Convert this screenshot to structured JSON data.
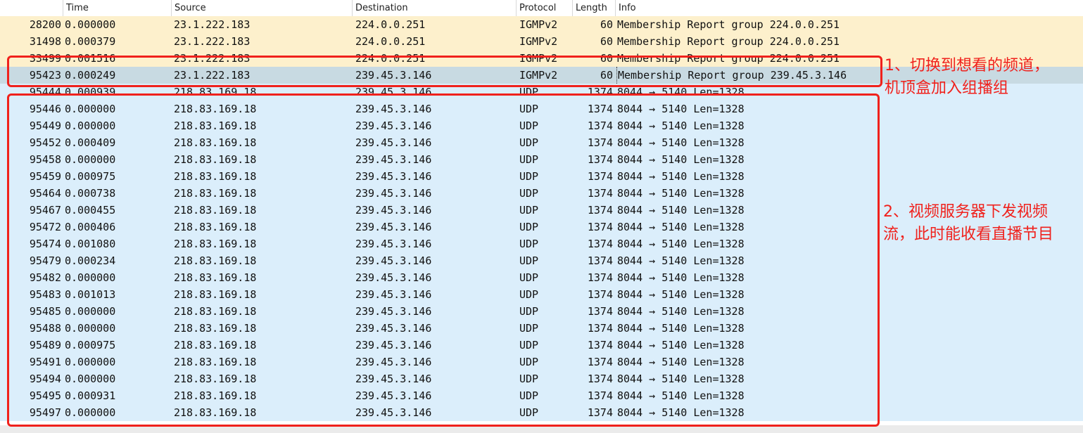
{
  "columns": {
    "no": "",
    "time": "Time",
    "source": "Source",
    "destination": "Destination",
    "protocol": "Protocol",
    "length": "Length",
    "info": "Info"
  },
  "packets": [
    {
      "no": "28200",
      "time": "0.000000",
      "source": "23.1.222.183",
      "destination": "224.0.0.251",
      "protocol": "IGMPv2",
      "length": "60",
      "info": "Membership Report group 224.0.0.251",
      "kind": "igmp"
    },
    {
      "no": "31498",
      "time": "0.000379",
      "source": "23.1.222.183",
      "destination": "224.0.0.251",
      "protocol": "IGMPv2",
      "length": "60",
      "info": "Membership Report group 224.0.0.251",
      "kind": "igmp"
    },
    {
      "no": "33499",
      "time": "0.001516",
      "source": "23.1.222.183",
      "destination": "224.0.0.251",
      "protocol": "IGMPv2",
      "length": "60",
      "info": "Membership Report group 224.0.0.251",
      "kind": "igmp"
    },
    {
      "no": "95423",
      "time": "0.000249",
      "source": "23.1.222.183",
      "destination": "239.45.3.146",
      "protocol": "IGMPv2",
      "length": "60",
      "info": "Membership Report group 239.45.3.146",
      "kind": "sel"
    },
    {
      "no": "95444",
      "time": "0.000939",
      "source": "218.83.169.18",
      "destination": "239.45.3.146",
      "protocol": "UDP",
      "length": "1374",
      "info": "8044 → 5140 Len=1328",
      "kind": "udp"
    },
    {
      "no": "95446",
      "time": "0.000000",
      "source": "218.83.169.18",
      "destination": "239.45.3.146",
      "protocol": "UDP",
      "length": "1374",
      "info": "8044 → 5140 Len=1328",
      "kind": "udp"
    },
    {
      "no": "95449",
      "time": "0.000000",
      "source": "218.83.169.18",
      "destination": "239.45.3.146",
      "protocol": "UDP",
      "length": "1374",
      "info": "8044 → 5140 Len=1328",
      "kind": "udp"
    },
    {
      "no": "95452",
      "time": "0.000409",
      "source": "218.83.169.18",
      "destination": "239.45.3.146",
      "protocol": "UDP",
      "length": "1374",
      "info": "8044 → 5140 Len=1328",
      "kind": "udp"
    },
    {
      "no": "95458",
      "time": "0.000000",
      "source": "218.83.169.18",
      "destination": "239.45.3.146",
      "protocol": "UDP",
      "length": "1374",
      "info": "8044 → 5140 Len=1328",
      "kind": "udp"
    },
    {
      "no": "95459",
      "time": "0.000975",
      "source": "218.83.169.18",
      "destination": "239.45.3.146",
      "protocol": "UDP",
      "length": "1374",
      "info": "8044 → 5140 Len=1328",
      "kind": "udp"
    },
    {
      "no": "95464",
      "time": "0.000738",
      "source": "218.83.169.18",
      "destination": "239.45.3.146",
      "protocol": "UDP",
      "length": "1374",
      "info": "8044 → 5140 Len=1328",
      "kind": "udp"
    },
    {
      "no": "95467",
      "time": "0.000455",
      "source": "218.83.169.18",
      "destination": "239.45.3.146",
      "protocol": "UDP",
      "length": "1374",
      "info": "8044 → 5140 Len=1328",
      "kind": "udp"
    },
    {
      "no": "95472",
      "time": "0.000406",
      "source": "218.83.169.18",
      "destination": "239.45.3.146",
      "protocol": "UDP",
      "length": "1374",
      "info": "8044 → 5140 Len=1328",
      "kind": "udp"
    },
    {
      "no": "95474",
      "time": "0.001080",
      "source": "218.83.169.18",
      "destination": "239.45.3.146",
      "protocol": "UDP",
      "length": "1374",
      "info": "8044 → 5140 Len=1328",
      "kind": "udp"
    },
    {
      "no": "95479",
      "time": "0.000234",
      "source": "218.83.169.18",
      "destination": "239.45.3.146",
      "protocol": "UDP",
      "length": "1374",
      "info": "8044 → 5140 Len=1328",
      "kind": "udp"
    },
    {
      "no": "95482",
      "time": "0.000000",
      "source": "218.83.169.18",
      "destination": "239.45.3.146",
      "protocol": "UDP",
      "length": "1374",
      "info": "8044 → 5140 Len=1328",
      "kind": "udp"
    },
    {
      "no": "95483",
      "time": "0.001013",
      "source": "218.83.169.18",
      "destination": "239.45.3.146",
      "protocol": "UDP",
      "length": "1374",
      "info": "8044 → 5140 Len=1328",
      "kind": "udp"
    },
    {
      "no": "95485",
      "time": "0.000000",
      "source": "218.83.169.18",
      "destination": "239.45.3.146",
      "protocol": "UDP",
      "length": "1374",
      "info": "8044 → 5140 Len=1328",
      "kind": "udp"
    },
    {
      "no": "95488",
      "time": "0.000000",
      "source": "218.83.169.18",
      "destination": "239.45.3.146",
      "protocol": "UDP",
      "length": "1374",
      "info": "8044 → 5140 Len=1328",
      "kind": "udp"
    },
    {
      "no": "95489",
      "time": "0.000975",
      "source": "218.83.169.18",
      "destination": "239.45.3.146",
      "protocol": "UDP",
      "length": "1374",
      "info": "8044 → 5140 Len=1328",
      "kind": "udp"
    },
    {
      "no": "95491",
      "time": "0.000000",
      "source": "218.83.169.18",
      "destination": "239.45.3.146",
      "protocol": "UDP",
      "length": "1374",
      "info": "8044 → 5140 Len=1328",
      "kind": "udp"
    },
    {
      "no": "95494",
      "time": "0.000000",
      "source": "218.83.169.18",
      "destination": "239.45.3.146",
      "protocol": "UDP",
      "length": "1374",
      "info": "8044 → 5140 Len=1328",
      "kind": "udp"
    },
    {
      "no": "95495",
      "time": "0.000931",
      "source": "218.83.169.18",
      "destination": "239.45.3.146",
      "protocol": "UDP",
      "length": "1374",
      "info": "8044 → 5140 Len=1328",
      "kind": "udp"
    },
    {
      "no": "95497",
      "time": "0.000000",
      "source": "218.83.169.18",
      "destination": "239.45.3.146",
      "protocol": "UDP",
      "length": "1374",
      "info": "8044 → 5140 Len=1328",
      "kind": "udp"
    }
  ],
  "annotations": {
    "note1": "1、切换到想看的频道，\n机顶盒加入组播组",
    "note2": "2、视频服务器下发视频\n流，此时能收看直播节目",
    "color": "#f0211c"
  },
  "colors": {
    "igmp_row": "#fdf0cc",
    "selected_row": "#c8dae2",
    "udp_row": "#dbeefb"
  }
}
